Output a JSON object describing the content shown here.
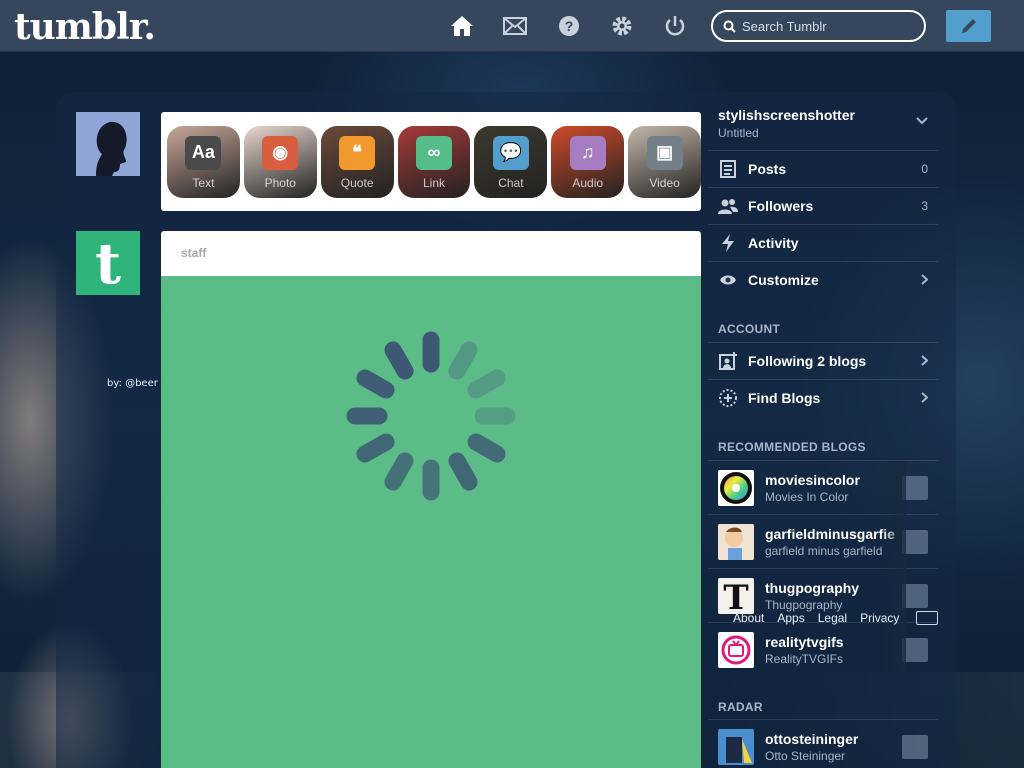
{
  "app": {
    "logo": "tumblr."
  },
  "nav": {
    "search_placeholder": "Search Tumblr",
    "icons": [
      "home-icon",
      "mail-icon",
      "help-icon",
      "gear-icon",
      "power-icon",
      "pencil-icon"
    ]
  },
  "credit": "by: @beer",
  "post_types": [
    {
      "label": "Text",
      "glyph": "Aa",
      "color": "#4a4a4a"
    },
    {
      "label": "Photo",
      "glyph": "◉",
      "color": "#d95e40"
    },
    {
      "label": "Quote",
      "glyph": "❝",
      "color": "#f2992e"
    },
    {
      "label": "Link",
      "glyph": "∞",
      "color": "#56bc8a"
    },
    {
      "label": "Chat",
      "glyph": "💬",
      "color": "#529ecc"
    },
    {
      "label": "Audio",
      "glyph": "♫",
      "color": "#a77dc2"
    },
    {
      "label": "Video",
      "glyph": "▣",
      "color": "#748089"
    }
  ],
  "post": {
    "author": "staff"
  },
  "sidebar": {
    "blog_name": "stylishscreenshotter",
    "blog_title": "Untitled",
    "menu": [
      {
        "label": "Posts",
        "count": "0"
      },
      {
        "label": "Followers",
        "count": "3"
      },
      {
        "label": "Activity",
        "count": ""
      },
      {
        "label": "Customize",
        "count": ""
      }
    ],
    "account_title": "ACCOUNT",
    "account": [
      {
        "label": "Following 2 blogs"
      },
      {
        "label": "Find Blogs"
      }
    ],
    "recommended_title": "RECOMMENDED BLOGS",
    "recommended": [
      {
        "name": "moviesincolor",
        "subtitle": "Movies In Color"
      },
      {
        "name": "garfieldminusgarfie",
        "subtitle": "garfield minus garfield"
      },
      {
        "name": "thugpography",
        "subtitle": "Thugpography"
      },
      {
        "name": "realitytvgifs",
        "subtitle": "RealityTVGIFs"
      }
    ],
    "radar_title": "RADAR",
    "radar": [
      {
        "name": "ottosteininger",
        "subtitle": "Otto Steininger"
      }
    ]
  },
  "footer": [
    "About",
    "Apps",
    "Legal",
    "Privacy"
  ],
  "colors": {
    "topbar": "#36465d",
    "accent": "#529ecc",
    "post_bg": "#5cbc88"
  }
}
